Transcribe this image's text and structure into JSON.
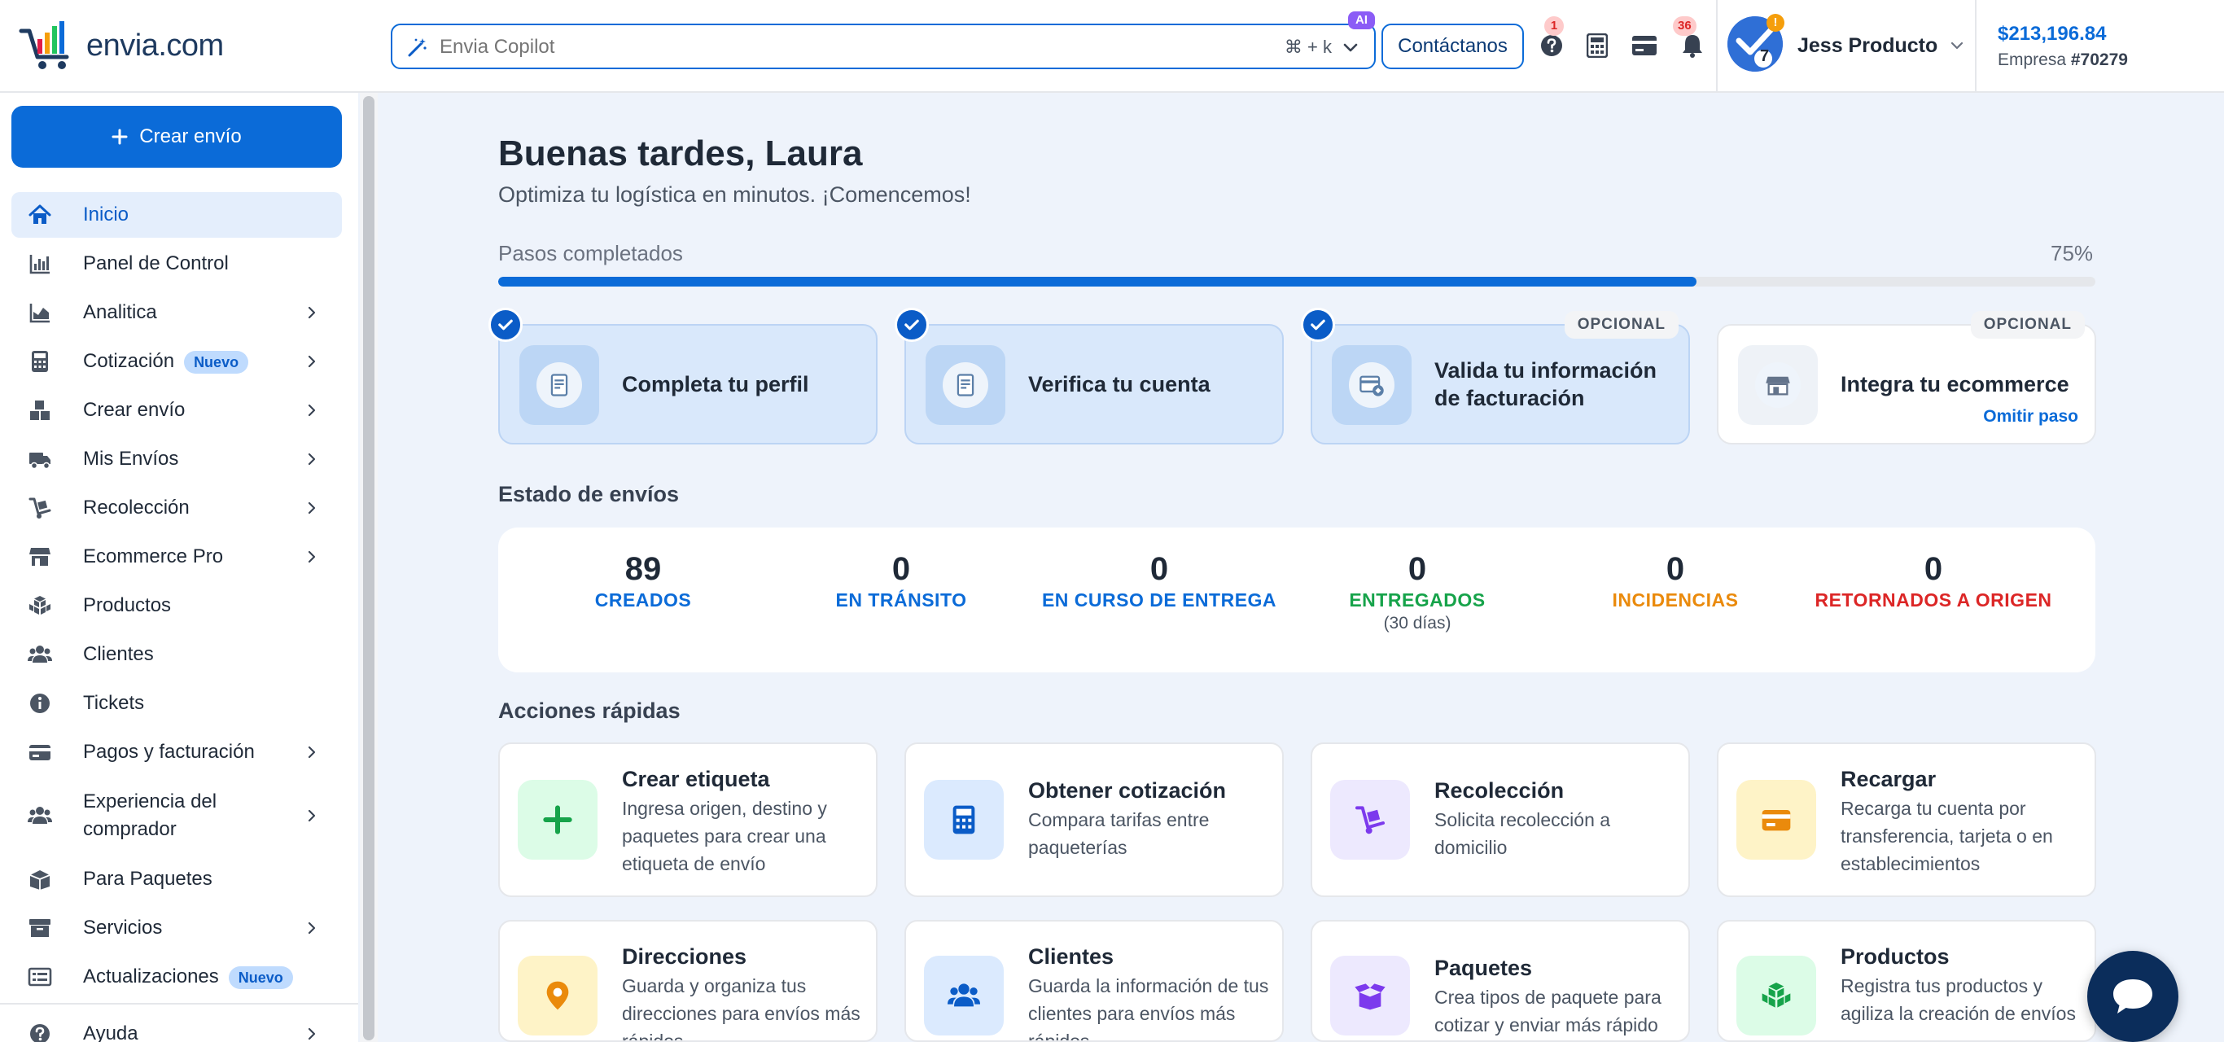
{
  "header": {
    "logo_text": "envia.com",
    "search": {
      "placeholder": "Envia Copilot",
      "shortcut": "⌘ + k",
      "ai_badge": "AI"
    },
    "contact_label": "Contáctanos",
    "help_badge": "1",
    "notif_badge": "36",
    "user": {
      "name": "Jess Producto",
      "avatar_badge": "!",
      "avatar_number": "7"
    },
    "balance": "$213,196.84",
    "company_prefix": "Empresa",
    "company_id": "#70279"
  },
  "sidebar": {
    "create_label": "Crear envío",
    "items": [
      {
        "label": "Inicio",
        "icon": "home-icon",
        "active": true
      },
      {
        "label": "Panel de Control",
        "icon": "bar-chart-icon"
      },
      {
        "label": "Analitica",
        "icon": "area-chart-icon",
        "arrow": true
      },
      {
        "label": "Cotización",
        "icon": "calculator-icon",
        "arrow": true,
        "badge": "Nuevo"
      },
      {
        "label": "Crear envío",
        "icon": "boxes-icon",
        "arrow": true
      },
      {
        "label": "Mis Envíos",
        "icon": "truck-icon",
        "arrow": true
      },
      {
        "label": "Recolección",
        "icon": "dolly-icon",
        "arrow": true
      },
      {
        "label": "Ecommerce Pro",
        "icon": "store-icon",
        "arrow": true
      },
      {
        "label": "Productos",
        "icon": "cubes-icon"
      },
      {
        "label": "Clientes",
        "icon": "users-icon"
      },
      {
        "label": "Tickets",
        "icon": "info-icon"
      },
      {
        "label": "Pagos y facturación",
        "icon": "credit-card-icon",
        "arrow": true
      },
      {
        "label_line1": "Experiencia del",
        "label_line2": "comprador",
        "icon": "users-icon",
        "arrow": true
      },
      {
        "label": "Para Paquetes",
        "icon": "package-icon"
      },
      {
        "label": "Servicios",
        "icon": "archive-icon",
        "arrow": true
      },
      {
        "label": "Actualizaciones",
        "icon": "list-icon",
        "badge": "Nuevo"
      },
      {
        "label": "Ayuda",
        "icon": "help-icon",
        "arrow": true
      }
    ]
  },
  "main": {
    "greeting": "Buenas tardes, Laura",
    "subtitle": "Optimiza tu logística en minutos. ¡Comencemos!",
    "progress": {
      "label": "Pasos completados",
      "percent_text": "75%",
      "value": 75
    },
    "steps": [
      {
        "title": "Completa tu perfil",
        "done": true
      },
      {
        "title": "Verifica tu cuenta",
        "done": true
      },
      {
        "title_line1": "Valida tu información",
        "title_line2": "de facturación",
        "done": true,
        "optional": "OPCIONAL"
      },
      {
        "title": "Integra tu ecommerce",
        "done": false,
        "optional": "OPCIONAL",
        "skip": "Omitir paso"
      }
    ],
    "status_title": "Estado de envíos",
    "stats": [
      {
        "num": "89",
        "label": "CREADOS",
        "color": "#0b6bd8"
      },
      {
        "num": "0",
        "label": "EN TRÁNSITO",
        "color": "#0b6bd8"
      },
      {
        "num": "0",
        "label": "EN CURSO DE ENTREGA",
        "color": "#0b6bd8"
      },
      {
        "num": "0",
        "label": "ENTREGADOS",
        "sub": "(30 días)",
        "color": "#16a34a"
      },
      {
        "num": "0",
        "label": "INCIDENCIAS",
        "color": "#ea8a0c"
      },
      {
        "num": "0",
        "label": "RETORNADOS A ORIGEN",
        "color": "#dc2626"
      }
    ],
    "quick_title": "Acciones rápidas",
    "quick": [
      {
        "title": "Crear etiqueta",
        "desc": "Ingresa origen, destino y paquetes para crear una etiqueta de envío",
        "icon": "plus-icon",
        "bg": "#dcfce7",
        "fg": "#16a34a"
      },
      {
        "title": "Obtener cotización",
        "desc": "Compara tarifas entre paqueterías",
        "icon": "calculator-icon",
        "bg": "#dbeafe",
        "fg": "#0b5cc7"
      },
      {
        "title": "Recolección",
        "desc": "Solicita recolección a domicilio",
        "icon": "dolly-icon",
        "bg": "#ede9fe",
        "fg": "#7c3aed"
      },
      {
        "title": "Recargar",
        "desc": "Recarga tu cuenta por transferencia, tarjeta o en establecimientos",
        "icon": "credit-card-icon",
        "bg": "#fef3c7",
        "fg": "#ea8a0c"
      },
      {
        "title": "Direcciones",
        "desc": "Guarda y organiza tus direcciones para envíos más rápidos",
        "icon": "map-pin-icon",
        "bg": "#fef3c7",
        "fg": "#ea8a0c"
      },
      {
        "title": "Clientes",
        "desc": "Guarda la información de tus clientes para envíos más rápidos",
        "icon": "users-icon",
        "bg": "#dbeafe",
        "fg": "#0b5cc7"
      },
      {
        "title": "Paquetes",
        "desc": "Crea tipos de paquete para cotizar y enviar más rápido",
        "icon": "box-open-icon",
        "bg": "#ede9fe",
        "fg": "#7c3aed"
      },
      {
        "title": "Productos",
        "desc": "Registra tus productos y agiliza la creación de envíos",
        "icon": "cubes-icon",
        "bg": "#dcfce7",
        "fg": "#16a34a"
      }
    ]
  }
}
